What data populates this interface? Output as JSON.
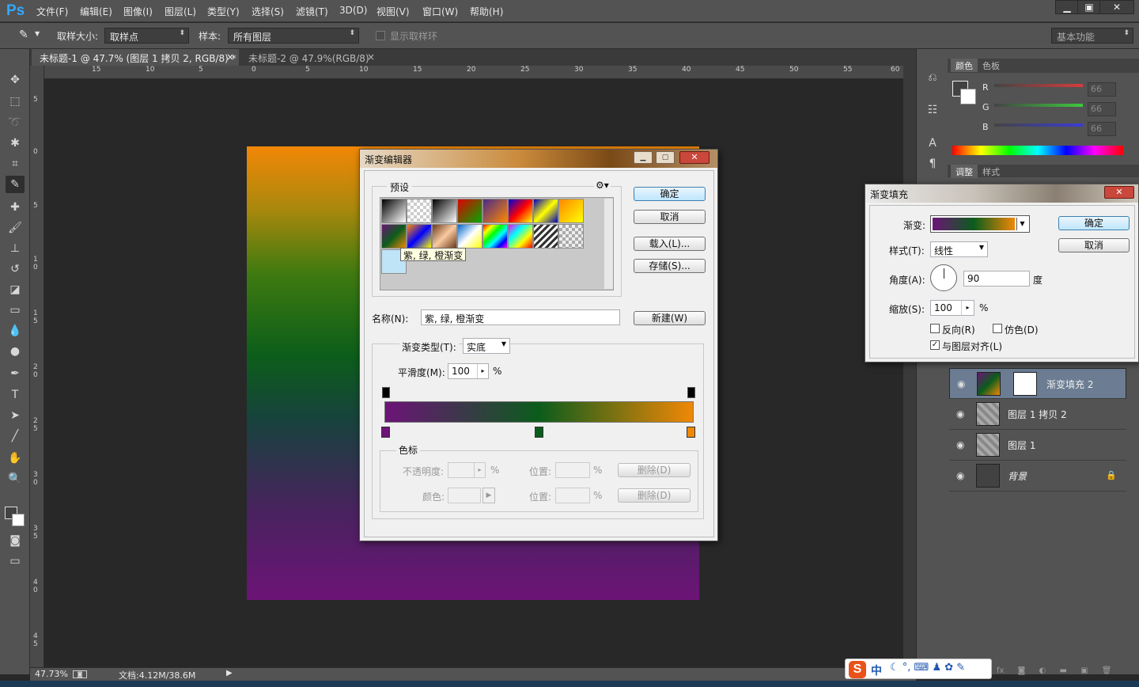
{
  "app": {
    "logo": "Ps"
  },
  "menubar": {
    "items": [
      "文件(F)",
      "编辑(E)",
      "图像(I)",
      "图层(L)",
      "类型(Y)",
      "选择(S)",
      "滤镜(T)",
      "3D(D)",
      "视图(V)",
      "窗口(W)",
      "帮助(H)"
    ]
  },
  "window_controls": {
    "min": "▁",
    "max": "▣",
    "close": "✕"
  },
  "options": {
    "sample_size_label": "取样大小:",
    "sample_size_value": "取样点",
    "sample_label": "样本:",
    "sample_value": "所有图层",
    "show_ring": "显示取样环",
    "workspace": "基本功能"
  },
  "tabs": [
    {
      "label": "未标题-1 @ 47.7% (图层 1 拷贝 2, RGB/8) *",
      "close": "×"
    },
    {
      "label": "未标题-2 @ 47.9%(RGB/8)",
      "close": "×"
    }
  ],
  "ruler": {
    "h": [
      "15",
      "10",
      "5",
      "0",
      "5",
      "10",
      "15",
      "20",
      "25",
      "30",
      "35",
      "40",
      "45",
      "50",
      "55",
      "60"
    ],
    "v": [
      "5",
      "0",
      "5",
      "1 0",
      "1 5",
      "2 0",
      "2 5",
      "3 0",
      "3 5",
      "4 0",
      "4 5"
    ]
  },
  "status": {
    "zoom": "47.73%",
    "doc": "文档:4.12M/38.6M"
  },
  "color_panel": {
    "tabs": [
      "颜色",
      "色板"
    ],
    "channels": [
      {
        "label": "R",
        "value": "66"
      },
      {
        "label": "G",
        "value": "66"
      },
      {
        "label": "B",
        "value": "66"
      }
    ],
    "colors": {
      "r": "#d73b3b",
      "g": "#3bc93b",
      "b": "#3b3bd7"
    }
  },
  "adjust_panel": {
    "tabs": [
      "调整",
      "样式"
    ]
  },
  "layers": [
    {
      "name": "渐变填充 2",
      "selected": true
    },
    {
      "name": "图层 1 拷贝 2",
      "selected": false
    },
    {
      "name": "图层 1",
      "selected": false
    },
    {
      "name": "背景",
      "selected": false
    }
  ],
  "gradient_editor": {
    "title": "渐变编辑器",
    "presets_label": "预设",
    "tooltip": "紫, 绿, 橙渐变",
    "ok": "确定",
    "cancel": "取消",
    "load": "载入(L)...",
    "save": "存储(S)...",
    "name_label": "名称(N):",
    "name_value": "紫, 绿, 橙渐变",
    "new": "新建(W)",
    "type_label": "渐变类型(T):",
    "type_value": "实底",
    "smooth_label": "平滑度(M):",
    "smooth_value": "100",
    "percent": "%",
    "stops_label": "色标",
    "opacity_label": "不透明度:",
    "color_label": "颜色:",
    "position_label": "位置:",
    "delete": "删除(D)",
    "gradient_colors": [
      "#6c1477",
      "#0b5c1c",
      "#f08806"
    ]
  },
  "gradient_fill": {
    "title": "渐变填充",
    "gradient_label": "渐变:",
    "style_label": "样式(T):",
    "style_value": "线性",
    "angle_label": "角度(A):",
    "angle_value": "90",
    "angle_unit": "度",
    "scale_label": "缩放(S):",
    "scale_value": "100",
    "scale_unit": "%",
    "reverse": "反向(R)",
    "dither": "仿色(D)",
    "align": "与图层对齐(L)",
    "ok": "确定",
    "cancel": "取消"
  },
  "ime": {
    "logo": "S",
    "lang": "中"
  }
}
